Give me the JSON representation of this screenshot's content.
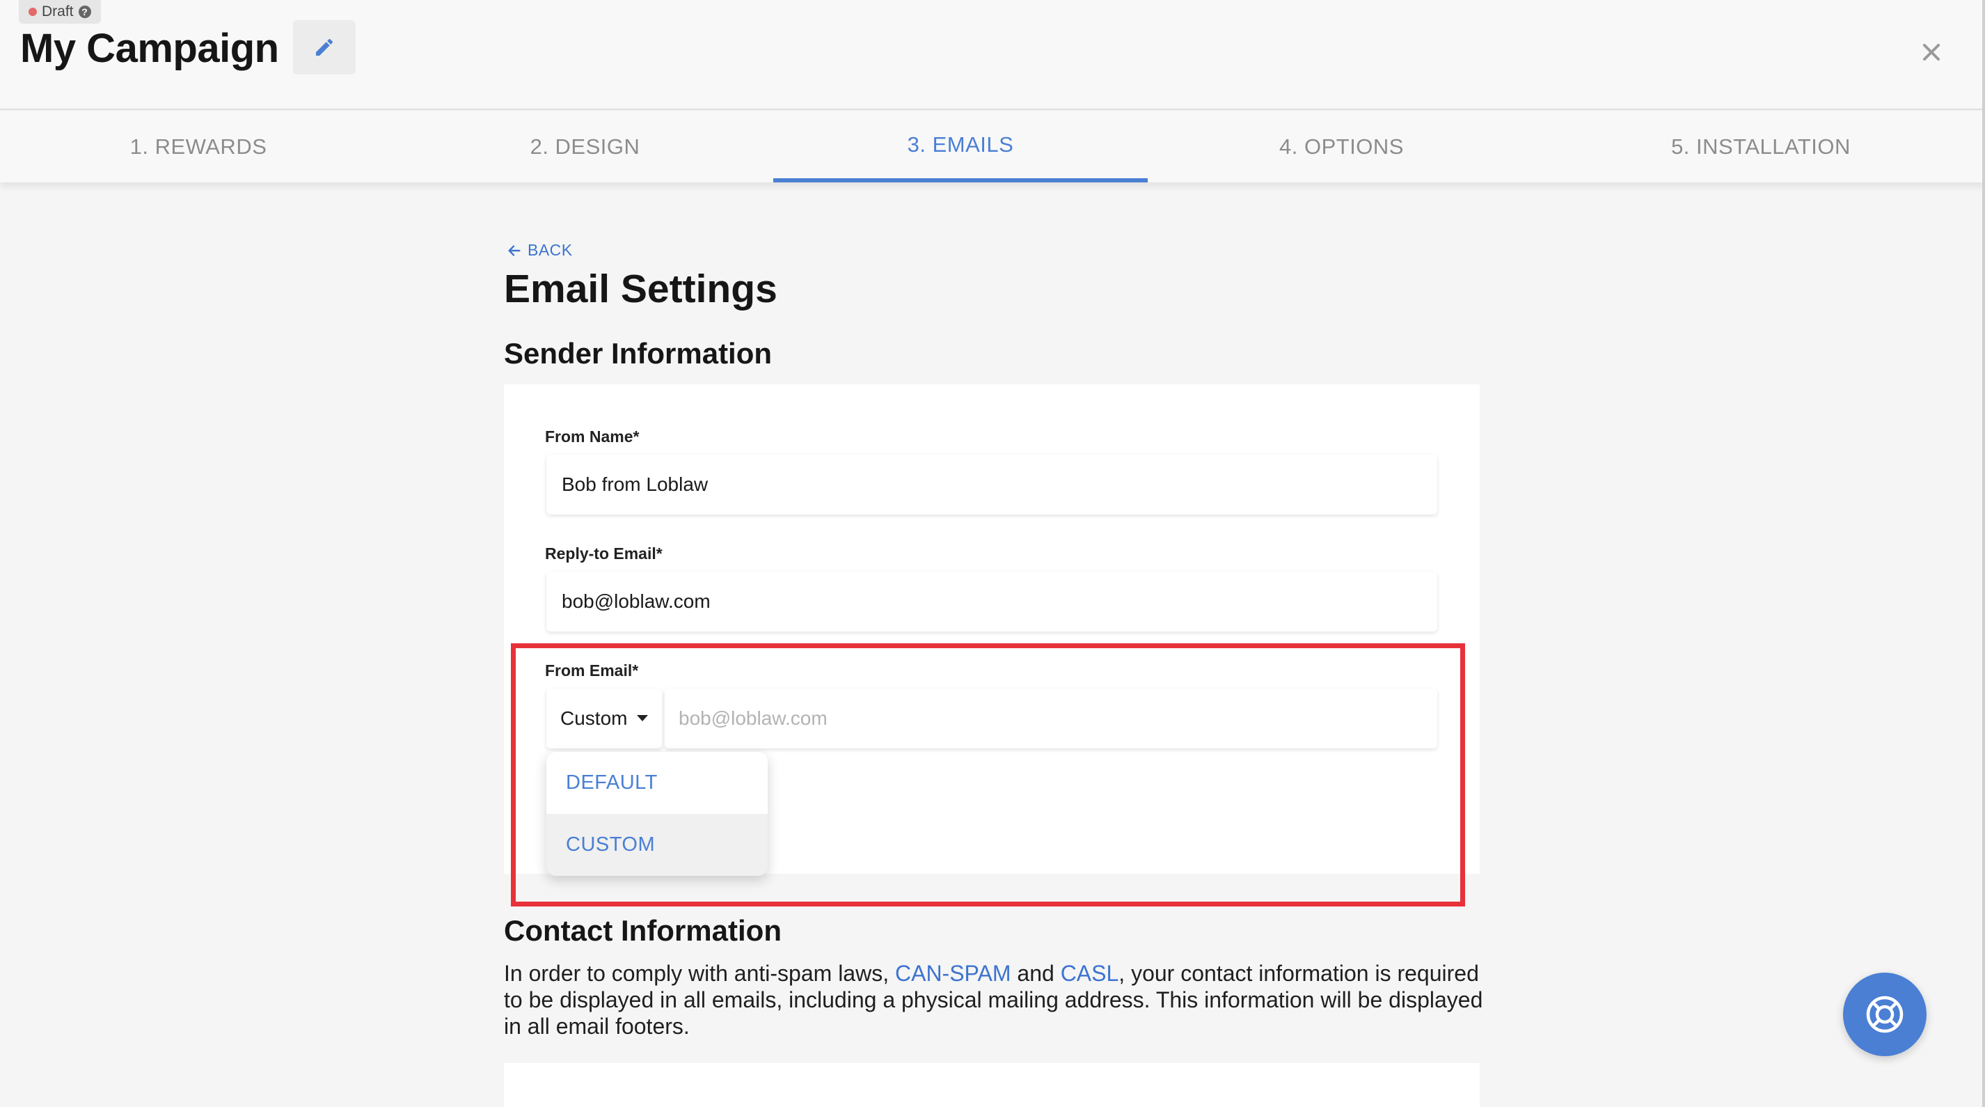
{
  "header": {
    "status_label": "Draft",
    "help_glyph": "?",
    "title": "My Campaign",
    "edit_icon": "pencil-icon",
    "close_icon": "close-icon"
  },
  "tabs": [
    {
      "label": "1. REWARDS",
      "active": false
    },
    {
      "label": "2. DESIGN",
      "active": false
    },
    {
      "label": "3. EMAILS",
      "active": true
    },
    {
      "label": "4. OPTIONS",
      "active": false
    },
    {
      "label": "5. INSTALLATION",
      "active": false
    }
  ],
  "main": {
    "back_label": "BACK",
    "title": "Email Settings",
    "sender_section": {
      "title": "Sender Information",
      "from_name": {
        "label": "From Name*",
        "value": "Bob from Loblaw"
      },
      "reply_to": {
        "label": "Reply-to Email*",
        "value": "bob@loblaw.com"
      },
      "from_email": {
        "label": "From Email*",
        "select_value": "Custom",
        "placeholder": "bob@loblaw.com",
        "options": [
          "DEFAULT",
          "CUSTOM"
        ]
      }
    },
    "contact_section": {
      "title": "Contact Information",
      "text_before": "In order to comply with anti-spam laws, ",
      "link1": "CAN-SPAM",
      "text_mid": " and ",
      "link2": "CASL",
      "text_after": ", your contact information is required to be displayed in all emails, including a physical mailing address. This information will be displayed in all email footers."
    }
  },
  "colors": {
    "accent": "#4a7fd4",
    "highlight": "#e7323a",
    "draft_dot": "#e36a6a"
  },
  "help_button_icon": "lifebuoy-icon"
}
